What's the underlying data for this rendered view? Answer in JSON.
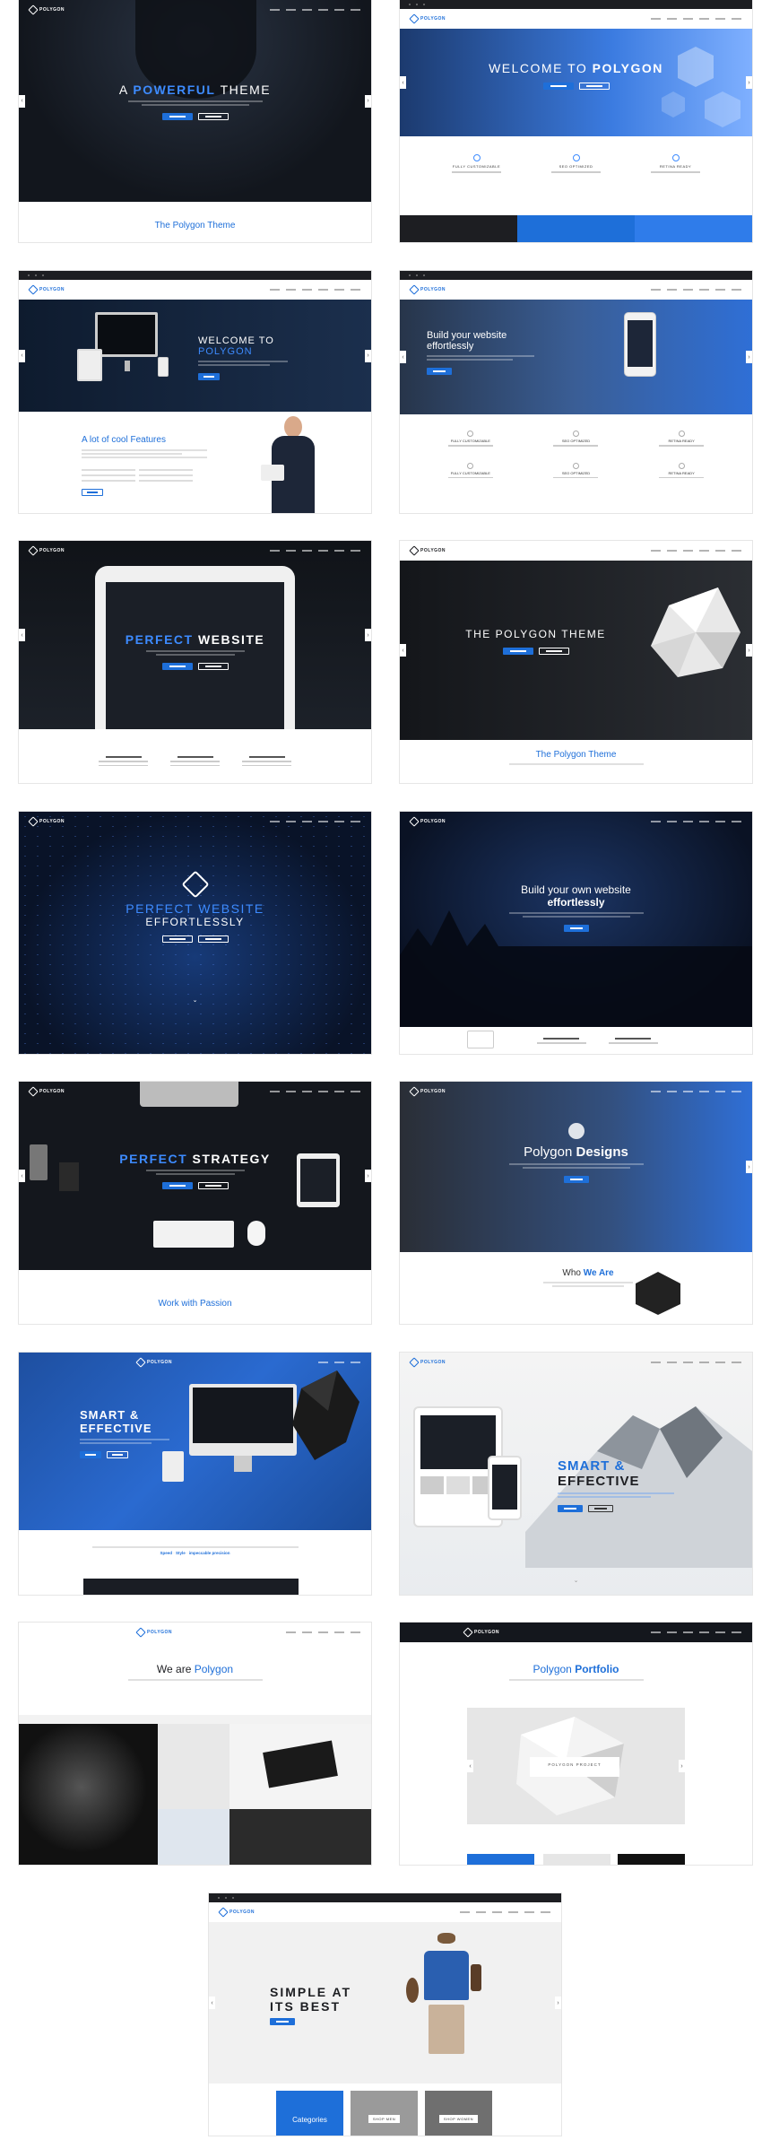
{
  "brand": "POLYGON",
  "colors": {
    "accent": "#1e6fd9",
    "dark": "#1a1d24",
    "light_accent": "#3d8bff"
  },
  "icons": [
    "polygon-logo-icon",
    "chevron-left-icon",
    "chevron-right-icon",
    "search-icon",
    "cart-icon",
    "chevron-down-icon"
  ],
  "theme1": {
    "h1_a": "A ",
    "h1_b": "POWERFUL",
    "h1_c": " THEME",
    "section": "The Polygon Theme"
  },
  "theme2": {
    "h1_a": "WELCOME TO ",
    "h1_b": "POLYGON",
    "features": [
      "FULLY CUSTOMIZABLE",
      "SEO OPTIMIZED",
      "RETINA READY"
    ]
  },
  "theme3": {
    "h1_a": "WELCOME TO",
    "h1_b": "POLYGON",
    "section": "A lot of cool Features"
  },
  "theme4": {
    "h1_a": "Build your website",
    "h1_b": "effortlessly",
    "features": [
      "FULLY CUSTOMIZABLE",
      "SEO OPTIMIZED",
      "RETINA READY",
      "FULLY CUSTOMIZABLE",
      "SEO OPTIMIZED",
      "RETINA READY"
    ]
  },
  "theme5": {
    "h1_a": "PERFECT",
    "h1_b": " WEBSITE"
  },
  "theme6": {
    "h1": "THE POLYGON THEME",
    "section": "The Polygon Theme"
  },
  "theme7": {
    "h1": "PERFECT WEBSITE",
    "h2": "EFFORTLESSLY"
  },
  "theme8": {
    "h1_a": "Build your own website",
    "h1_b": "effortlessly"
  },
  "theme9": {
    "h1_a": "PERFECT",
    "h1_b": " STRATEGY",
    "section": "Work with Passion"
  },
  "theme10": {
    "h1_a": "Polygon ",
    "h1_b": "Designs",
    "section_a": "Who ",
    "section_b": "We Are"
  },
  "theme11": {
    "h1_a": "SMART &",
    "h1_b": "EFFECTIVE",
    "link_a": "Speed",
    "link_b": "Style",
    "link_c": "impeccable precision"
  },
  "theme12": {
    "h1_a": "SMART &",
    "h1_b": "EFFECTIVE"
  },
  "theme13": {
    "h1_a": "We are ",
    "h1_b": "Polygon"
  },
  "theme14": {
    "h1_a": "Polygon ",
    "h1_b": "Portfolio",
    "project": "POLYGON PROJECT"
  },
  "theme15": {
    "h1_a": "SIMPLE AT",
    "h1_b": "ITS BEST",
    "tiles": [
      "Categories",
      "SHOP MEN",
      "SHOP WOMEN"
    ]
  }
}
